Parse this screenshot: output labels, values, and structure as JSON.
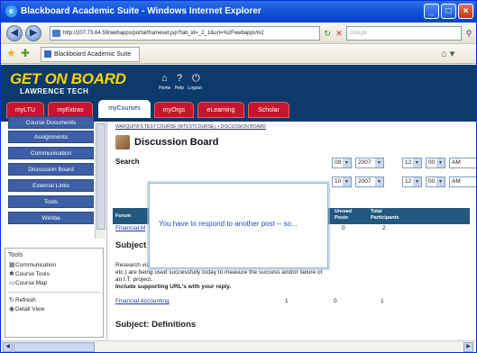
{
  "window": {
    "title": "Blackboard Academic Suite - Windows Internet Explorer"
  },
  "browser": {
    "address": "http://207.73.64.59/webapps/portal/frameset.jsp?tab_id=_2_1&url=%2Fwebapps%2",
    "search_placeholder": "Google",
    "tab_label": "Blackboard Academic Suite"
  },
  "header": {
    "logo_top": "GET ON BOARD",
    "logo_bottom": "LAWRENCE TECH",
    "links": [
      "Home",
      "Help",
      "Logout"
    ]
  },
  "nav_tabs": [
    {
      "label": "myLTU",
      "active": false
    },
    {
      "label": "myExtras",
      "active": false
    },
    {
      "label": "myCourses",
      "active": true
    },
    {
      "label": "myOrgs",
      "active": false
    },
    {
      "label": "eLearning",
      "active": false
    },
    {
      "label": "Scholar",
      "active": false
    }
  ],
  "sidebar": {
    "buttons": [
      "Course Documents",
      "Assignments",
      "Communication",
      "Discussion Board",
      "External Links",
      "Tools",
      "Wimba"
    ],
    "tools_heading": "Tools",
    "tools": [
      "Communication",
      "Course Tools",
      "Course Map"
    ],
    "actions": [
      "Refresh",
      "Detail View"
    ]
  },
  "main": {
    "breadcrumb": "WARQUITA'S TEST COURSE (WTESTCOURSE)",
    "breadcrumb_rest": " > DISCUSSION BOARD",
    "title": "Discussion Board",
    "search_label": "Search",
    "date1": {
      "day": "09",
      "year": "2007",
      "hour": "12",
      "minute": "00",
      "ampm": "AM"
    },
    "date2": {
      "day": "10",
      "year": "2007",
      "hour": "12",
      "minute": "00",
      "ampm": "AM"
    },
    "table_headers": {
      "forum": "Forum",
      "unread": "Unread Posts",
      "total": "Total Participants"
    },
    "first_row": {
      "link": "Financial M",
      "unread": "0",
      "total": "2"
    },
    "subject1": "Subject Financial Measures for Projects",
    "description": "Research via the Web to determine which \"financial measures\" (NPV, BE, ROI, etc.) are being used successfully today to measure the success and/or failure of an I.T. project.",
    "description_bold": "Include supporting URL's with your reply.",
    "row2": {
      "link": "Financial Accounting",
      "a": "1",
      "b": "0",
      "c": "1"
    },
    "subject2": "Subject: Definitions"
  },
  "modal": {
    "message": "You have to respond to another post -- so..."
  }
}
